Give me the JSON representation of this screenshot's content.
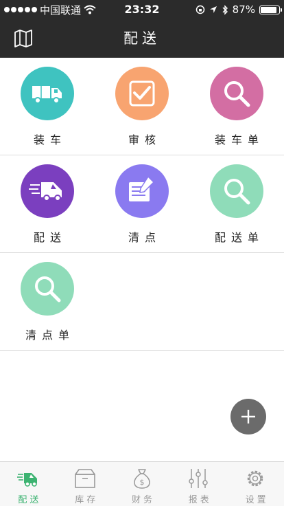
{
  "status_bar": {
    "carrier": "中国联通",
    "time": "23:32",
    "battery": "87%",
    "battery_level": 0.87
  },
  "header": {
    "title": "配送"
  },
  "grid": [
    {
      "label": "装车",
      "icon": "truck-icon",
      "color": "#3fc3c0"
    },
    {
      "label": "审核",
      "icon": "checkbox-icon",
      "color": "#f8a470"
    },
    {
      "label": "装车单",
      "icon": "search-icon",
      "color": "#d36ea3"
    },
    {
      "label": "配送",
      "icon": "delivery-truck-icon",
      "color": "#7b3fbf"
    },
    {
      "label": "清点",
      "icon": "document-pen-icon",
      "color": "#8a7af0"
    },
    {
      "label": "配送单",
      "icon": "search-icon",
      "color": "#8fdcb9"
    },
    {
      "label": "清点单",
      "icon": "search-icon",
      "color": "#8fdcb9"
    }
  ],
  "fab": {
    "icon": "plus-icon"
  },
  "tabs": [
    {
      "label": "配送",
      "icon": "delivery-icon",
      "active": true
    },
    {
      "label": "库存",
      "icon": "box-icon",
      "active": false
    },
    {
      "label": "财务",
      "icon": "money-bag-icon",
      "active": false
    },
    {
      "label": "报表",
      "icon": "sliders-icon",
      "active": false
    },
    {
      "label": "设置",
      "icon": "gear-icon",
      "active": false
    }
  ],
  "colors": {
    "header_bg": "#2b2b2b",
    "tab_active": "#3cb371",
    "tab_inactive": "#999999"
  }
}
